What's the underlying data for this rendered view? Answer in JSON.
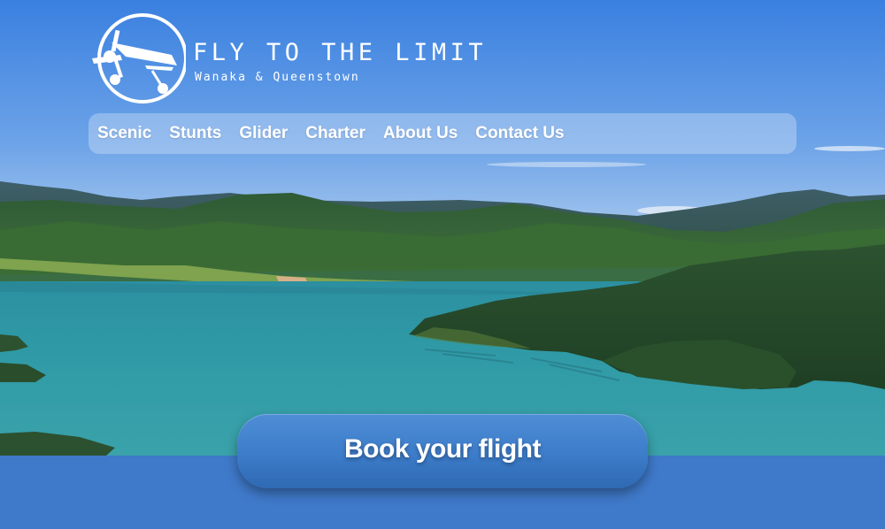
{
  "brand": {
    "title": "FLY TO THE LIMIT",
    "subtitle": "Wanaka & Queenstown",
    "logo_icon": "plane-logo-icon"
  },
  "nav": {
    "items": [
      {
        "label": "Scenic"
      },
      {
        "label": "Stunts"
      },
      {
        "label": "Glider"
      },
      {
        "label": "Charter"
      },
      {
        "label": "About Us"
      },
      {
        "label": "Contact Us"
      }
    ]
  },
  "cta": {
    "label": "Book your flight"
  },
  "colors": {
    "sky": "#3f86e0",
    "water": "#2e9aa3",
    "page_bg": "#3f79c9",
    "button": "#3c7cc9"
  }
}
